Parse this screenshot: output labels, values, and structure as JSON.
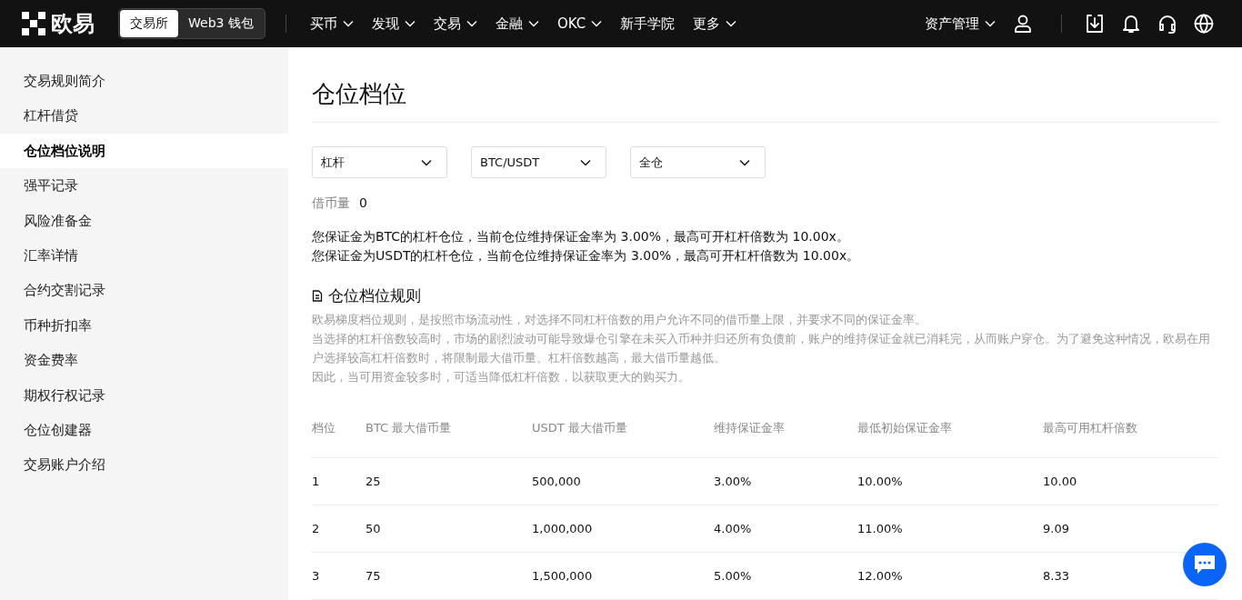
{
  "header": {
    "logo": "欧易",
    "mode_tabs": [
      {
        "label": "交易所",
        "selected": true
      },
      {
        "label": "Web3 钱包",
        "selected": false
      }
    ],
    "nav": [
      {
        "label": "买币",
        "has_menu": true
      },
      {
        "label": "发现",
        "has_menu": true
      },
      {
        "label": "交易",
        "has_menu": true
      },
      {
        "label": "金融",
        "has_menu": true
      },
      {
        "label": "OKC",
        "has_menu": true
      },
      {
        "label": "新手学院",
        "has_menu": false
      },
      {
        "label": "更多",
        "has_menu": true
      }
    ],
    "asset_menu": "资产管理"
  },
  "sidebar": {
    "items": [
      {
        "label": "交易规则简介",
        "selected": false
      },
      {
        "label": "杠杆借贷",
        "selected": false
      },
      {
        "label": "仓位档位说明",
        "selected": true
      },
      {
        "label": "强平记录",
        "selected": false
      },
      {
        "label": "风险准备金",
        "selected": false
      },
      {
        "label": "汇率详情",
        "selected": false
      },
      {
        "label": "合约交割记录",
        "selected": false
      },
      {
        "label": "币种折扣率",
        "selected": false
      },
      {
        "label": "资金费率",
        "selected": false
      },
      {
        "label": "期权行权记录",
        "selected": false
      },
      {
        "label": "仓位创建器",
        "selected": false
      },
      {
        "label": "交易账户介绍",
        "selected": false
      }
    ]
  },
  "main": {
    "title": "仓位档位",
    "filters": [
      {
        "value": "杠杆"
      },
      {
        "value": "BTC/USDT"
      },
      {
        "value": "全仓"
      }
    ],
    "borrow": {
      "label": "借币量",
      "value": "0"
    },
    "notes": [
      "您保证金为BTC的杠杆仓位，当前仓位维持保证金率为 3.00%，最高可开杠杆倍数为 10.00x。",
      "您保证金为USDT的杠杆仓位，当前仓位维持保证金率为 3.00%，最高可开杠杆倍数为 10.00x。"
    ],
    "rules": {
      "title": "仓位档位规则",
      "paragraphs": [
        "欧易梯度档位规则，是按照市场流动性，对选择不同杠杆倍数的用户允许不同的借币量上限，并要求不同的保证金率。",
        "当选择的杠杆倍数较高时，市场的剧烈波动可能导致爆仓引擎在未买入币种并归还所有负债前，账户的维持保证金就已消耗完，从而账户穿仓。为了避免这种情况，欧易在用户选择较高杠杆倍数时，将限制最大借币量。杠杆倍数越高，最大借币量越低。",
        "因此，当可用资金较多时，可适当降低杠杆倍数，以获取更大的购买力。"
      ]
    },
    "table": {
      "columns": [
        "档位",
        "BTC 最大借币量",
        "USDT 最大借币量",
        "维持保证金率",
        "最低初始保证金率",
        "最高可用杠杆倍数"
      ],
      "rows": [
        [
          "1",
          "25",
          "500,000",
          "3.00%",
          "10.00%",
          "10.00"
        ],
        [
          "2",
          "50",
          "1,000,000",
          "4.00%",
          "11.00%",
          "9.09"
        ],
        [
          "3",
          "75",
          "1,500,000",
          "5.00%",
          "12.00%",
          "8.33"
        ]
      ]
    }
  }
}
